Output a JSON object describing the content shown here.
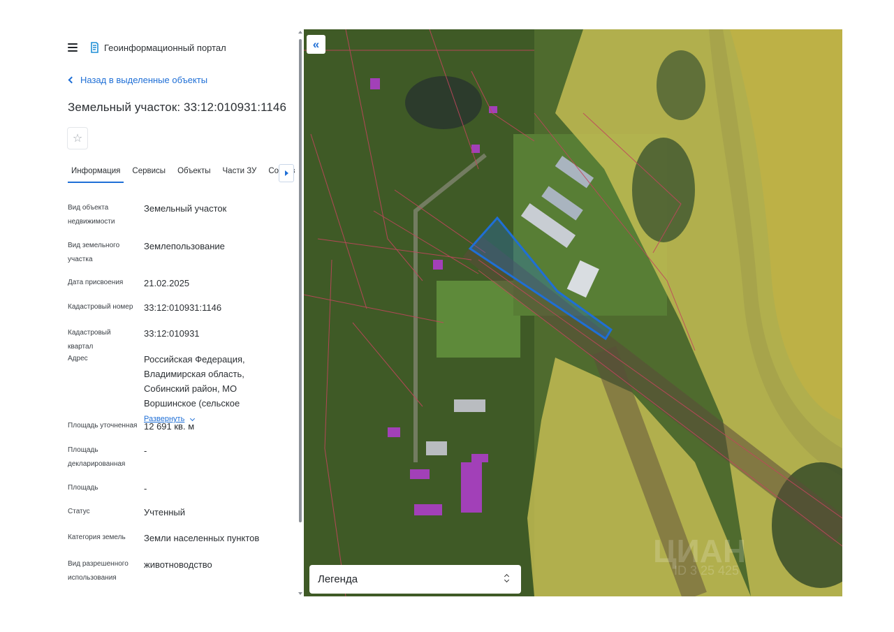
{
  "header": {
    "portal_title": "Геоинформационный портал"
  },
  "nav": {
    "back_label": "Назад в выделенные объекты"
  },
  "object": {
    "title": "Земельный участок: 33:12:010931:1146",
    "favorite_icon": "star-icon"
  },
  "tabs": [
    {
      "label": "Информация",
      "active": true
    },
    {
      "label": "Сервисы"
    },
    {
      "label": "Объекты"
    },
    {
      "label": "Части ЗУ"
    },
    {
      "label": "Состав"
    }
  ],
  "details": [
    {
      "label": "Вид объекта недвижимости",
      "value": "Земельный участок"
    },
    {
      "label": "Вид земельного участка",
      "value": "Землепользование"
    },
    {
      "label": "Дата присвоения",
      "value": "21.02.2025"
    },
    {
      "label": "Кадастровый номер",
      "value": "33:12:010931:1146"
    },
    {
      "label": "Кадастровый квартал",
      "value": "33:12:010931"
    },
    {
      "label": "Адрес",
      "value": "Российская Федерация, Владимирская область, Собинский район, МО Воршинское (сельское",
      "expand_label": "Развернуть"
    },
    {
      "label": "Площадь уточненная",
      "value": "12 691 кв. м"
    },
    {
      "label": "Площадь декларированная",
      "value": "-"
    },
    {
      "label": "Площадь",
      "value": "-"
    },
    {
      "label": "Статус",
      "value": "Учтенный"
    },
    {
      "label": "Категория земель",
      "value": "Земли населенных пунктов"
    },
    {
      "label": "Вид разрешенного использования",
      "value": "животноводство"
    }
  ],
  "map": {
    "collapse_label": "«",
    "legend_label": "Легенда",
    "watermark": "ЦИАН",
    "watermark_id": "ID 3  25  425",
    "colors": {
      "parcel": "#1f6fd6",
      "zone": "#e8e27a",
      "boundary": "#c0465c",
      "building_marker": "#b43cd2"
    }
  }
}
